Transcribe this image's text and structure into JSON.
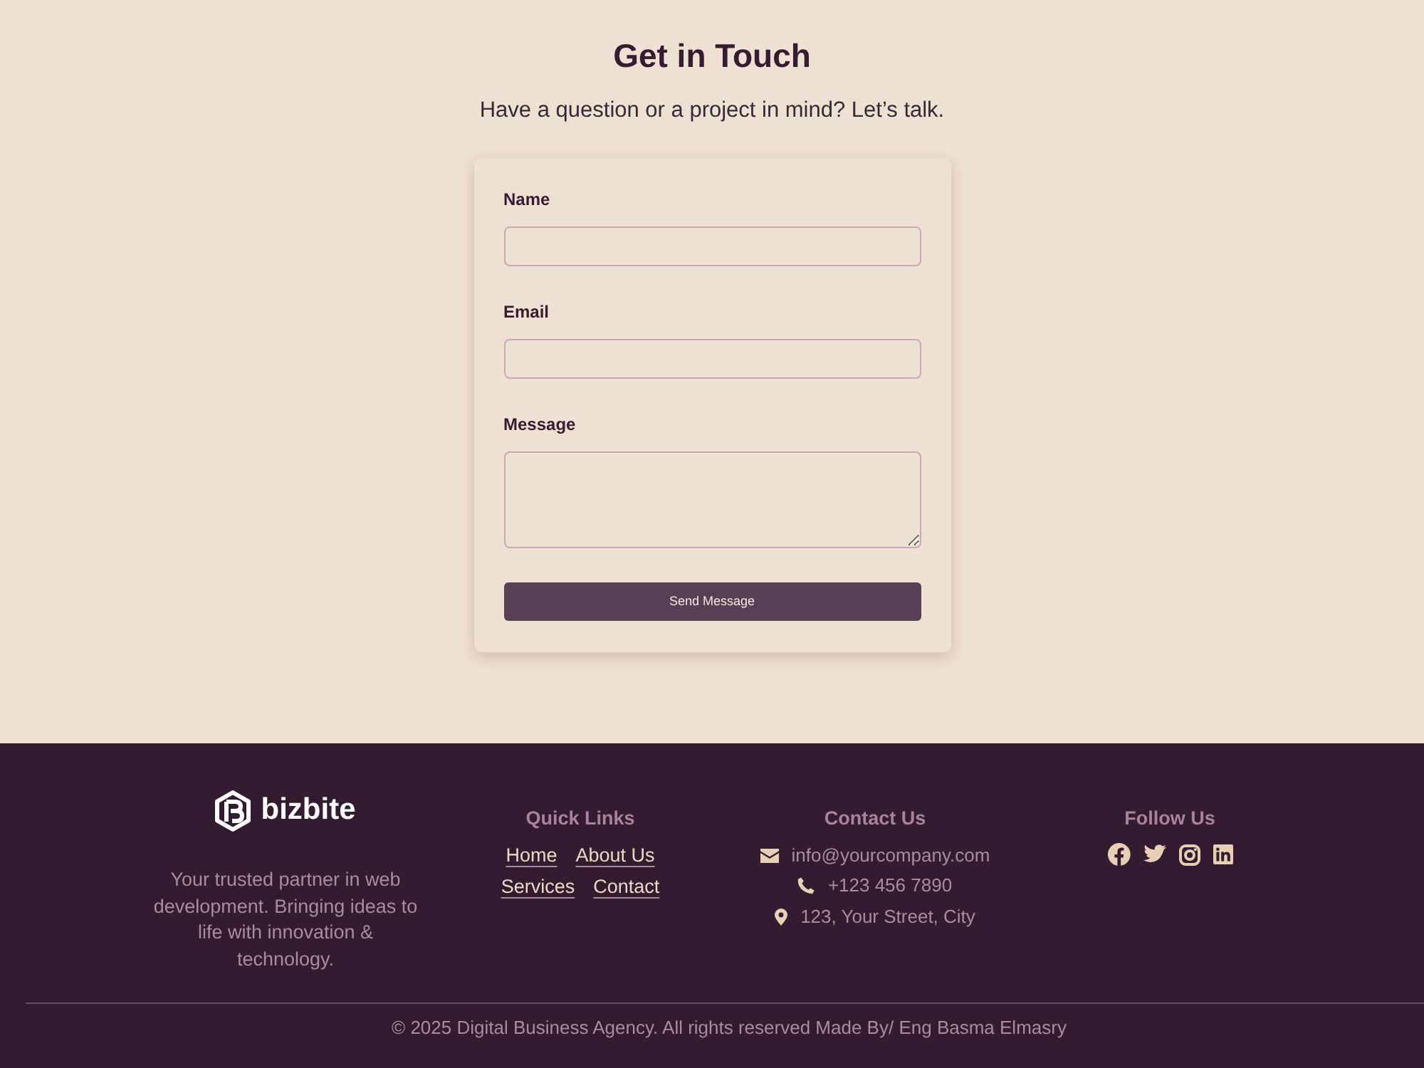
{
  "header": {
    "title": "Get in Touch",
    "subtitle": "Have a question or a project in mind? Let’s talk."
  },
  "form": {
    "fields": [
      {
        "label": "Name",
        "kind": "input"
      },
      {
        "label": "Email",
        "kind": "input"
      },
      {
        "label": "Message",
        "kind": "textarea"
      }
    ],
    "submit": "Send Message"
  },
  "footer": {
    "brand": {
      "name": "bizbite",
      "description": "Your trusted partner in web development. Bringing ideas to life with innovation & technology."
    },
    "quick_links": {
      "title": "Quick Links",
      "links": [
        "Home",
        "About Us",
        "Services",
        "Contact"
      ]
    },
    "contact": {
      "title": "Contact Us",
      "items": [
        {
          "kind": "email",
          "text": "info@yourcompany.com"
        },
        {
          "kind": "phone",
          "text": "+123 456 7890"
        },
        {
          "kind": "address",
          "text": "123, Your Street, City"
        }
      ]
    },
    "follow": {
      "title": "Follow Us",
      "items": [
        {
          "kind": "facebook"
        },
        {
          "kind": "twitter"
        },
        {
          "kind": "instagram"
        },
        {
          "kind": "linkedin"
        }
      ]
    },
    "copyright": "© 2025 Digital Business Agency. All rights reserved Made By/ Eng Basma Elmasry"
  }
}
